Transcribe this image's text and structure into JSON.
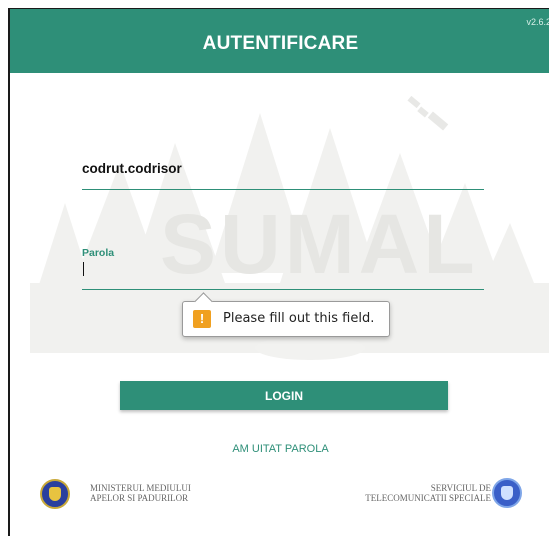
{
  "header": {
    "title": "AUTENTIFICARE",
    "version": "v2.6.2",
    "background": "#2e8f78"
  },
  "watermark": {
    "text": "SUMAL"
  },
  "form": {
    "username_value": "codrut.codrisor",
    "password_label": "Parola",
    "password_value": "",
    "validation_message": "Please fill out this field.",
    "login_label": "LOGIN",
    "forgot_label": "AM UITAT PAROLA"
  },
  "footer": {
    "left_org_line1": "MINISTERUL MEDIULUI",
    "left_org_line2": "APELOR SI PADURILOR",
    "right_org_line1": "SERVICIUL DE",
    "right_org_line2": "TELECOMUNICATII SPECIALE"
  },
  "icons": {
    "warning": "warning-icon",
    "satellite": "satellite-icon",
    "left_logo": "ministry-logo",
    "right_logo": "sts-logo"
  },
  "colors": {
    "accent": "#2e8f78",
    "warning": "#f0a020"
  }
}
